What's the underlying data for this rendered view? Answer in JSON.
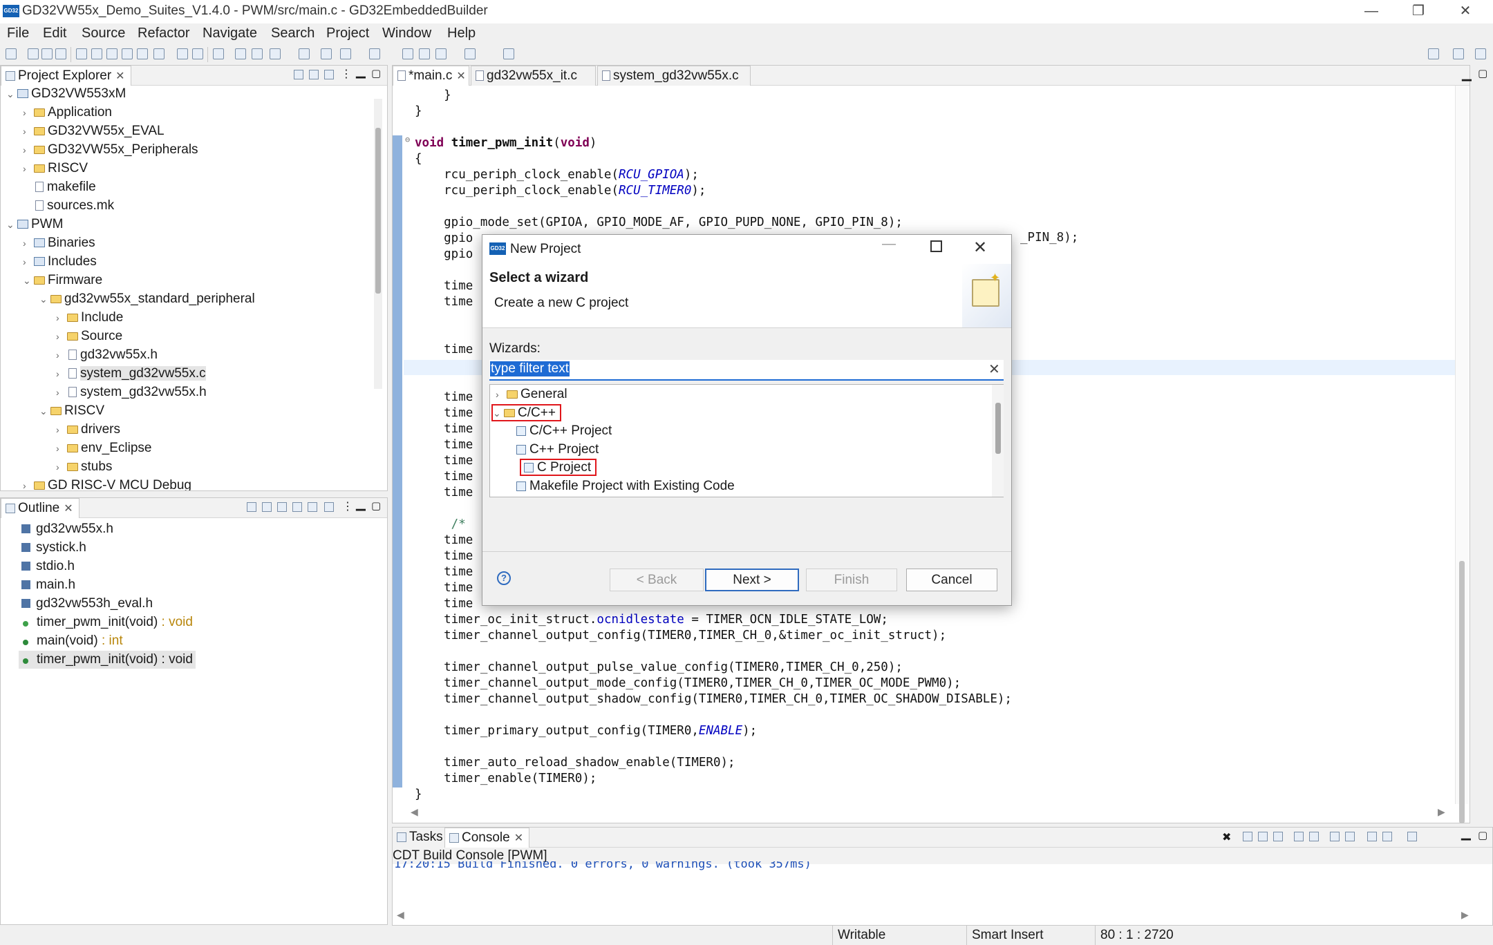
{
  "window": {
    "title": "GD32VW55x_Demo_Suites_V1.4.0 - PWM/src/main.c - GD32EmbeddedBuilder",
    "logo_text": "GD32",
    "minimize": "—",
    "restore": "❐",
    "close": "✕"
  },
  "menu": [
    "File",
    "Edit",
    "Source",
    "Refactor",
    "Navigate",
    "Search",
    "Project",
    "Window",
    "Help"
  ],
  "project_explorer": {
    "tab_label": "Project Explorer",
    "items": [
      {
        "label": "GD32VW553xM",
        "level": 0,
        "expanded": true,
        "icon": "project-icon"
      },
      {
        "label": "Application",
        "level": 1,
        "expanded": false,
        "icon": "folder-icon"
      },
      {
        "label": "GD32VW55x_EVAL",
        "level": 1,
        "expanded": false,
        "icon": "folder-icon"
      },
      {
        "label": "GD32VW55x_Peripherals",
        "level": 1,
        "expanded": false,
        "icon": "folder-icon"
      },
      {
        "label": "RISCV",
        "level": 1,
        "expanded": false,
        "icon": "folder-icon"
      },
      {
        "label": "makefile",
        "level": 1,
        "expanded": null,
        "icon": "file-icon"
      },
      {
        "label": "sources.mk",
        "level": 1,
        "expanded": null,
        "icon": "file-icon"
      },
      {
        "label": "PWM",
        "level": 0,
        "expanded": true,
        "icon": "project-icon"
      },
      {
        "label": "Binaries",
        "level": 1,
        "expanded": false,
        "icon": "binaries-icon"
      },
      {
        "label": "Includes",
        "level": 1,
        "expanded": false,
        "icon": "includes-icon"
      },
      {
        "label": "Firmware",
        "level": 1,
        "expanded": true,
        "icon": "folder-icon"
      },
      {
        "label": "gd32vw55x_standard_peripheral",
        "level": 2,
        "expanded": true,
        "icon": "folder-icon"
      },
      {
        "label": "Include",
        "level": 3,
        "expanded": false,
        "icon": "folder-icon"
      },
      {
        "label": "Source",
        "level": 3,
        "expanded": false,
        "icon": "folder-icon"
      },
      {
        "label": "gd32vw55x.h",
        "level": 3,
        "expanded": false,
        "icon": "file-icon"
      },
      {
        "label": "system_gd32vw55x.c",
        "level": 3,
        "expanded": false,
        "icon": "file-icon",
        "selected": true
      },
      {
        "label": "system_gd32vw55x.h",
        "level": 3,
        "expanded": false,
        "icon": "file-icon"
      },
      {
        "label": "RISCV",
        "level": 2,
        "expanded": true,
        "icon": "folder-icon"
      },
      {
        "label": "drivers",
        "level": 3,
        "expanded": false,
        "icon": "folder-icon"
      },
      {
        "label": "env_Eclipse",
        "level": 3,
        "expanded": false,
        "icon": "folder-icon"
      },
      {
        "label": "stubs",
        "level": 3,
        "expanded": false,
        "icon": "folder-icon"
      },
      {
        "label": "GD RISC-V MCU Debug",
        "level": 1,
        "expanded": false,
        "icon": "folder-icon"
      }
    ]
  },
  "outline": {
    "tab_label": "Outline",
    "items": [
      {
        "label": "gd32vw55x.h",
        "type": "",
        "icon": "include-icon"
      },
      {
        "label": "systick.h",
        "type": "",
        "icon": "include-icon"
      },
      {
        "label": "stdio.h",
        "type": "",
        "icon": "include-icon"
      },
      {
        "label": "main.h",
        "type": "",
        "icon": "include-icon"
      },
      {
        "label": "gd32vw553h_eval.h",
        "type": "",
        "icon": "include-icon"
      },
      {
        "label": "timer_pwm_init(void)",
        "type": " : void",
        "icon": "function-decl-icon"
      },
      {
        "label": "main(void)",
        "type": " : int",
        "icon": "function-icon"
      },
      {
        "label": "timer_pwm_init(void) : void",
        "type": "",
        "icon": "function-icon",
        "selected": true
      }
    ]
  },
  "editor": {
    "tabs": [
      {
        "label": "*main.c",
        "active": true,
        "closable": true
      },
      {
        "label": "gd32vw55x_it.c",
        "active": false,
        "closable": false
      },
      {
        "label": "system_gd32vw55x.c",
        "active": false,
        "closable": false
      }
    ],
    "lines": [
      {
        "t": "    }"
      },
      {
        "t": "}"
      },
      {
        "t": ""
      },
      {
        "t": "void timer_pwm_init(void)",
        "fold": true
      },
      {
        "t": "{"
      },
      {
        "t": "    rcu_periph_clock_enable(RCU_GPIOA);"
      },
      {
        "t": "    rcu_periph_clock_enable(RCU_TIMER0);"
      },
      {
        "t": ""
      },
      {
        "t": "    gpio_mode_set(GPIOA, GPIO_MODE_AF, GPIO_PUPD_NONE, GPIO_PIN_8);"
      },
      {
        "t": "    gpio"
      },
      {
        "t": "    gpio"
      },
      {
        "t": ""
      },
      {
        "t": "    time"
      },
      {
        "t": "    time"
      },
      {
        "t": ""
      },
      {
        "t": ""
      },
      {
        "t": "    time"
      },
      {
        "t": ""
      },
      {
        "t": ""
      },
      {
        "t": "    time"
      },
      {
        "t": "    time"
      },
      {
        "t": "    time"
      },
      {
        "t": "    time"
      },
      {
        "t": "    time"
      },
      {
        "t": "    time"
      },
      {
        "t": "    time"
      },
      {
        "t": ""
      },
      {
        "t": "     /*"
      },
      {
        "t": "    time"
      },
      {
        "t": "    time"
      },
      {
        "t": "    time"
      },
      {
        "t": "    time"
      },
      {
        "t": "    time"
      },
      {
        "t": "    timer_oc_init_struct.ocnidlestate = TIMER_OCN_IDLE_STATE_LOW;"
      },
      {
        "t": "    timer_channel_output_config(TIMER0,TIMER_CH_0,&timer_oc_init_struct);"
      },
      {
        "t": ""
      },
      {
        "t": "    timer_channel_output_pulse_value_config(TIMER0,TIMER_CH_0,250);"
      },
      {
        "t": "    timer_channel_output_mode_config(TIMER0,TIMER_CH_0,TIMER_OC_MODE_PWM0);"
      },
      {
        "t": "    timer_channel_output_shadow_config(TIMER0,TIMER_CH_0,TIMER_OC_SHADOW_DISABLE);"
      },
      {
        "t": ""
      },
      {
        "t": "    timer_primary_output_config(TIMER0,ENABLE);"
      },
      {
        "t": ""
      },
      {
        "t": "    timer_auto_reload_shadow_enable(TIMER0);"
      },
      {
        "t": "    timer_enable(TIMER0);"
      },
      {
        "t": "}"
      }
    ],
    "behind_dialog_fragment": "_PIN_8);"
  },
  "dialog": {
    "title": "New Project",
    "logo_text": "GD32",
    "heading": "Select a wizard",
    "subheading": "Create a new C project",
    "wizards_label": "Wizards:",
    "filter_placeholder": "type filter text",
    "filter_value": "type filter text",
    "tree": [
      {
        "label": "General",
        "level": 0,
        "expanded": false,
        "icon": "folder-icon"
      },
      {
        "label": "C/C++",
        "level": 0,
        "expanded": true,
        "icon": "folder-icon",
        "highlighted": true
      },
      {
        "label": "C/C++ Project",
        "level": 1,
        "icon": "wizard-icon"
      },
      {
        "label": "C++ Project",
        "level": 1,
        "icon": "wizard-icon"
      },
      {
        "label": "C Project",
        "level": 1,
        "icon": "wizard-icon",
        "highlighted": true
      },
      {
        "label": "Makefile Project with Existing Code",
        "level": 1,
        "icon": "wizard-icon"
      }
    ],
    "buttons": {
      "help": "?",
      "back": "< Back",
      "next": "Next >",
      "finish": "Finish",
      "cancel": "Cancel"
    },
    "highlight_color": "#e0161b"
  },
  "console": {
    "tabs": [
      {
        "label": "Tasks",
        "active": false
      },
      {
        "label": "Console",
        "active": true
      }
    ],
    "header": "CDT Build Console [PWM]",
    "output": "17:20:15 Build Finished. 0 errors, 0 warnings. (took 357ms)"
  },
  "status": {
    "mode": "Writable",
    "insert": "Smart Insert",
    "position": "80 : 1 : 2720"
  },
  "colors": {
    "keyword": "#7f0055",
    "constant": "#0000c0",
    "selection": "#3399ff",
    "accent": "#1461b4"
  }
}
